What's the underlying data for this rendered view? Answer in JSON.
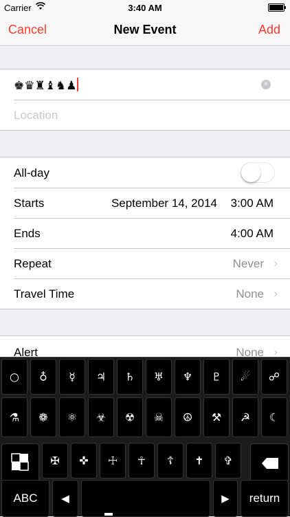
{
  "status": {
    "carrier": "Carrier",
    "time": "3:40 AM"
  },
  "nav": {
    "cancel": "Cancel",
    "title": "New Event",
    "add": "Add"
  },
  "event": {
    "title": "♚♛♜♝♞♟",
    "clear_glyph": "×",
    "location_placeholder": "Location"
  },
  "rows": {
    "allday": "All-day",
    "starts": "Starts",
    "start_date": "September 14, 2014",
    "start_time": "3:00 AM",
    "ends": "Ends",
    "end_time": "4:00 AM",
    "repeat": "Repeat",
    "repeat_value": "Never",
    "travel": "Travel Time",
    "travel_value": "None",
    "alert": "Alert",
    "alert_value": "None"
  },
  "chevron": "›",
  "keyboard": {
    "row1": [
      "○",
      "♁",
      "☿",
      "♃",
      "♄",
      "♅",
      "♆",
      "♇",
      "☄",
      "☍"
    ],
    "row2": [
      "⚗",
      "❁",
      "⚛",
      "☣",
      "☢",
      "☠",
      "☮",
      "⚒",
      "☭",
      "☾"
    ],
    "row3": [
      "✠",
      "✜",
      "☩",
      "☥",
      "☦",
      "✝",
      "✞"
    ],
    "abc": "ABC",
    "left": "◀",
    "right": "▶",
    "return": "return"
  }
}
